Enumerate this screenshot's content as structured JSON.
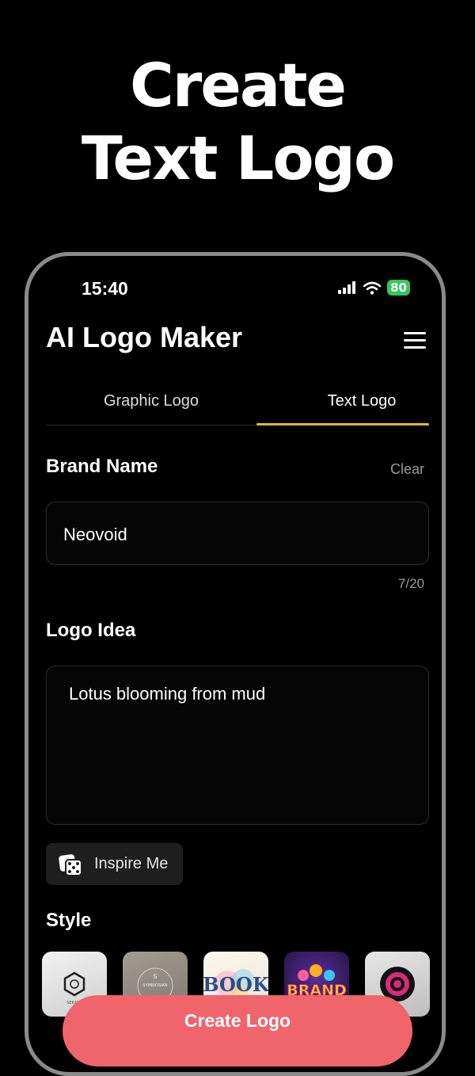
{
  "headline": {
    "line1": "Create",
    "line2": "Text Logo"
  },
  "status_bar": {
    "time": "15:40",
    "battery": "80"
  },
  "app": {
    "title": "AI Logo Maker"
  },
  "tabs": [
    {
      "label": "Graphic Logo"
    },
    {
      "label": "Text Logo",
      "active": true
    }
  ],
  "brand": {
    "label": "Brand Name",
    "clear_label": "Clear",
    "value": "Neovoid",
    "counter": "7/20"
  },
  "idea": {
    "label": "Logo Idea",
    "value": "Lotus blooming from mud"
  },
  "inspire": {
    "label": "Inspire Me"
  },
  "style": {
    "label": "Style",
    "thumbs": [
      {
        "text": "SEKARA"
      },
      {
        "text": "SYMBIOSIAN"
      },
      {
        "text": "BOOK"
      },
      {
        "text": "BRAND"
      },
      {
        "text": ""
      }
    ]
  },
  "cta": {
    "label": "Create Logo"
  },
  "colors": {
    "accent": "#e5b13a",
    "cta": "#f0646b",
    "battery": "#34c759"
  }
}
